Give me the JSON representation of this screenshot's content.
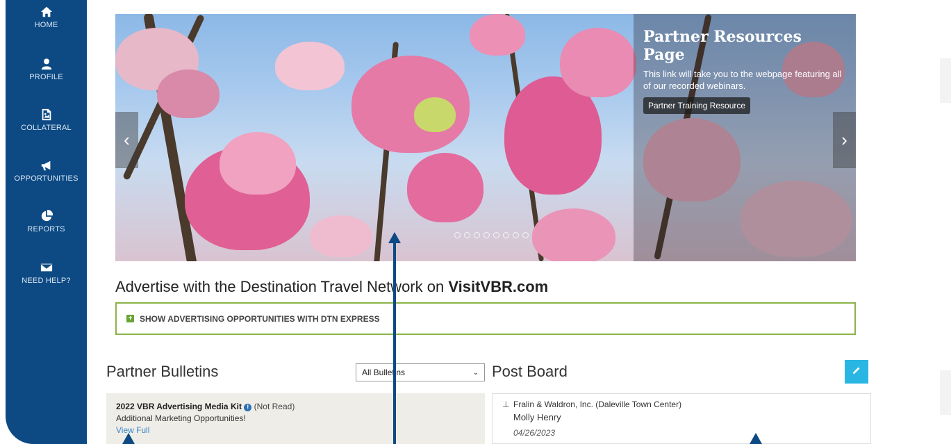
{
  "sidebar": {
    "items": [
      {
        "label": "HOME",
        "icon": "home-icon"
      },
      {
        "label": "PROFILE",
        "icon": "user-icon"
      },
      {
        "label": "COLLATERAL",
        "icon": "image-file-icon"
      },
      {
        "label": "OPPORTUNITIES",
        "icon": "megaphone-icon"
      },
      {
        "label": "REPORTS",
        "icon": "pie-chart-icon"
      },
      {
        "label": "NEED HELP?",
        "icon": "envelope-icon"
      }
    ]
  },
  "carousel": {
    "overlay_title": "Partner Resources Page",
    "overlay_text": "This link will take you to the webpage featuring all of our recorded webinars.",
    "cta_label": "Partner Training Resource",
    "prev_icon": "‹",
    "next_icon": "›"
  },
  "advertise": {
    "title_prefix": "Advertise with the Destination Travel Network on ",
    "title_bold": "VisitVBR.com",
    "toggle_label": "SHOW ADVERTISING OPPORTUNITIES WITH DTN EXPRESS"
  },
  "bulletins": {
    "title": "Partner Bulletins",
    "filter_value": "All Bulletins",
    "item": {
      "title": "2022 VBR Advertising Media Kit",
      "status": "(Not Read)",
      "subtitle": "Additional Marketing Opportunities!",
      "link": "View Full"
    }
  },
  "post_board": {
    "title": "Post Board",
    "post": {
      "organization": "Fralin & Waldron, Inc. (Daleville Town Center)",
      "author": "Molly Henry",
      "date": "04/26/2023"
    }
  },
  "colors": {
    "sidebar": "#0d4a84",
    "accent_green": "#8ab34a",
    "edit_button": "#2ab6e3",
    "link": "#3a86c8"
  }
}
